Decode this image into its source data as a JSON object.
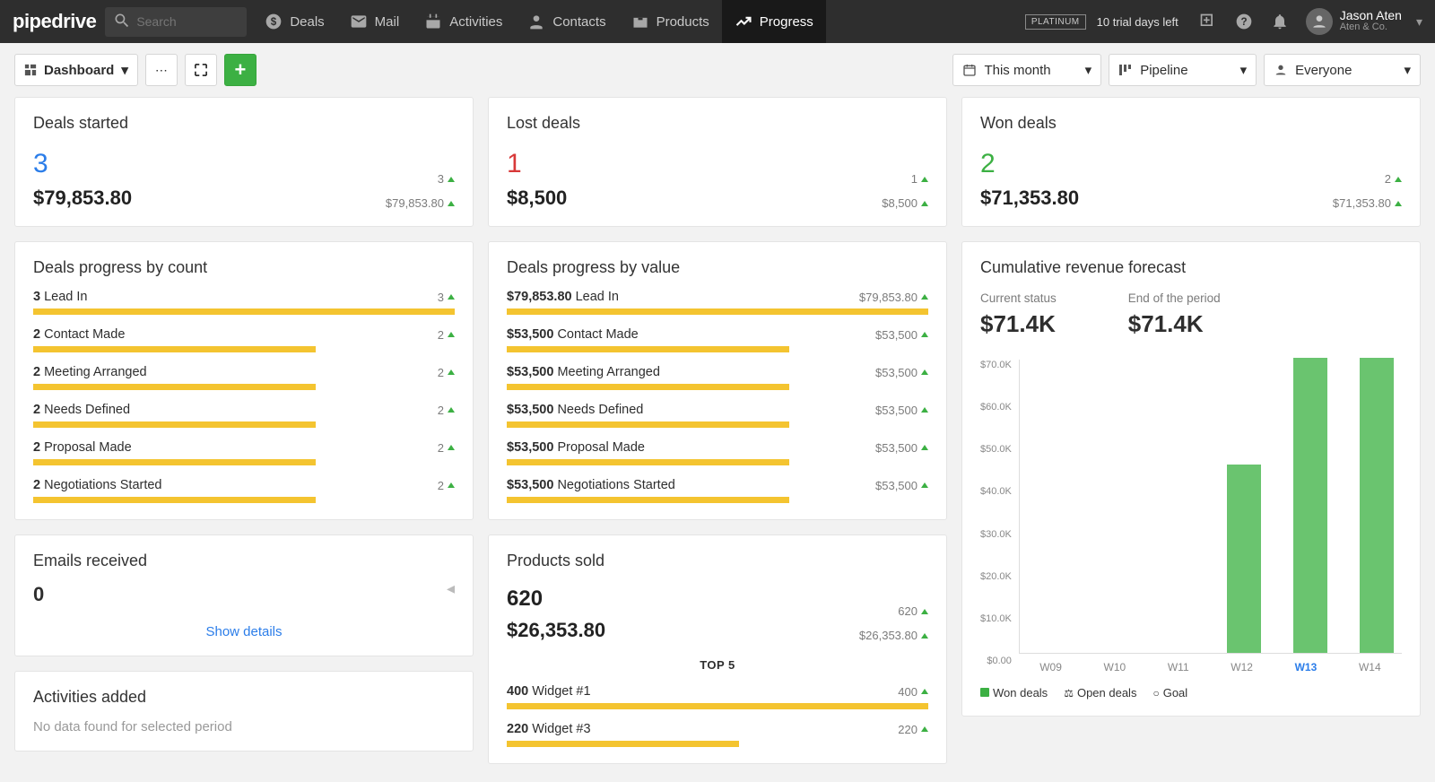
{
  "brand": "pipedrive",
  "search": {
    "placeholder": "Search"
  },
  "nav": [
    {
      "label": "Deals",
      "icon": "dollar"
    },
    {
      "label": "Mail",
      "icon": "mail"
    },
    {
      "label": "Activities",
      "icon": "calendar"
    },
    {
      "label": "Contacts",
      "icon": "person"
    },
    {
      "label": "Products",
      "icon": "box"
    },
    {
      "label": "Progress",
      "icon": "trend"
    }
  ],
  "plan_badge": "PLATINUM",
  "trial": "10 trial days left",
  "user": {
    "name": "Jason Aten",
    "sub": "Aten & Co."
  },
  "subbar": {
    "dashboard": "Dashboard",
    "period": "This month",
    "pipeline": "Pipeline",
    "people": "Everyone"
  },
  "cards": {
    "deals_started": {
      "title": "Deals started",
      "big": "3",
      "amount": "$79,853.80",
      "r1": "3",
      "r2": "$79,853.80"
    },
    "lost_deals": {
      "title": "Lost deals",
      "big": "1",
      "amount": "$8,500",
      "r1": "1",
      "r2": "$8,500"
    },
    "won_deals": {
      "title": "Won deals",
      "big": "2",
      "amount": "$71,353.80",
      "r1": "2",
      "r2": "$71,353.80"
    },
    "emails": {
      "title": "Emails received",
      "zero": "0",
      "show": "Show details"
    },
    "activities": {
      "title": "Activities added",
      "nodata": "No data found for selected period"
    },
    "products": {
      "title": "Products sold",
      "big": "620",
      "amount": "$26,353.80",
      "r1": "620",
      "r2": "$26,353.80",
      "top5": "TOP 5",
      "rows": [
        {
          "bold": "400",
          "label": "Widget #1",
          "rval": "400",
          "pct": 100
        },
        {
          "bold": "220",
          "label": "Widget #3",
          "rval": "220",
          "pct": 55
        }
      ]
    },
    "forecast": {
      "title": "Cumulative revenue forecast",
      "cs_label": "Current status",
      "cs": "$71.4K",
      "ep_label": "End of the period",
      "ep": "$71.4K"
    }
  },
  "progress_count": {
    "title": "Deals progress by count",
    "rows": [
      {
        "bold": "3",
        "label": "Lead In",
        "rval": "3",
        "pct": 100
      },
      {
        "bold": "2",
        "label": "Contact Made",
        "rval": "2",
        "pct": 67
      },
      {
        "bold": "2",
        "label": "Meeting Arranged",
        "rval": "2",
        "pct": 67
      },
      {
        "bold": "2",
        "label": "Needs Defined",
        "rval": "2",
        "pct": 67
      },
      {
        "bold": "2",
        "label": "Proposal Made",
        "rval": "2",
        "pct": 67
      },
      {
        "bold": "2",
        "label": "Negotiations Started",
        "rval": "2",
        "pct": 67
      }
    ]
  },
  "progress_value": {
    "title": "Deals progress by value",
    "rows": [
      {
        "bold": "$79,853.80",
        "label": "Lead In",
        "rval": "$79,853.80",
        "pct": 100
      },
      {
        "bold": "$53,500",
        "label": "Contact Made",
        "rval": "$53,500",
        "pct": 67
      },
      {
        "bold": "$53,500",
        "label": "Meeting Arranged",
        "rval": "$53,500",
        "pct": 67
      },
      {
        "bold": "$53,500",
        "label": "Needs Defined",
        "rval": "$53,500",
        "pct": 67
      },
      {
        "bold": "$53,500",
        "label": "Proposal Made",
        "rval": "$53,500",
        "pct": 67
      },
      {
        "bold": "$53,500",
        "label": "Negotiations Started",
        "rval": "$53,500",
        "pct": 67
      }
    ]
  },
  "chart_data": {
    "type": "bar",
    "title": "Cumulative revenue forecast",
    "ylabel": "",
    "ylim": [
      0,
      70000
    ],
    "y_ticks": [
      "$70.0K",
      "$60.0K",
      "$50.0K",
      "$40.0K",
      "$30.0K",
      "$20.0K",
      "$10.0K",
      "$0.00"
    ],
    "categories": [
      "W09",
      "W10",
      "W11",
      "W12",
      "W13",
      "W14"
    ],
    "series": [
      {
        "name": "Won deals",
        "values": [
          0,
          0,
          0,
          45000,
          70500,
          70500
        ]
      }
    ],
    "legend": [
      "Won deals",
      "Open deals",
      "Goal"
    ],
    "highlight": "W13"
  }
}
